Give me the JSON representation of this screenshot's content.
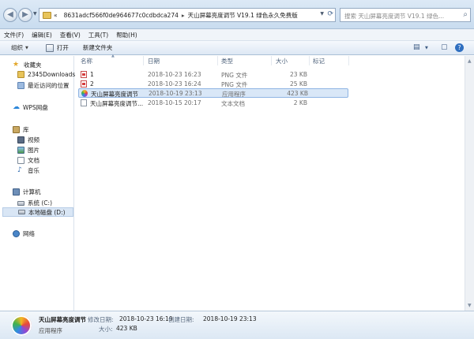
{
  "address": {
    "breadcrumb_prefix": "«",
    "crumbs": [
      "8631adcf566f0de964677c0cdbdca274",
      "天山屏幕亮度调节 V19.1 绿色永久免费版"
    ],
    "search_placeholder": "搜索 天山屏幕亮度调节 V19.1 绿色..."
  },
  "menu": [
    "文件(F)",
    "编辑(E)",
    "查看(V)",
    "工具(T)",
    "帮助(H)"
  ],
  "commands": {
    "organize": "组织",
    "open": "打开",
    "new_folder": "新建文件夹"
  },
  "sidebar": {
    "favorites": "收藏夹",
    "downloads": "2345Downloads",
    "recent": "最近访问的位置",
    "wps": "WPS网盘",
    "library": "库",
    "videos": "视频",
    "pictures": "图片",
    "documents": "文档",
    "music": "音乐",
    "computer": "计算机",
    "drive_c": "系统 (C:)",
    "drive_d": "本地磁盘 (D:)",
    "network": "网络"
  },
  "columns": {
    "name": "名称",
    "date": "日期",
    "type": "类型",
    "size": "大小",
    "tags": "标记"
  },
  "files": [
    {
      "name": "1",
      "date": "2018-10-23 16:23",
      "type": "PNG 文件",
      "size": "23 KB",
      "icon": "png-file-icon"
    },
    {
      "name": "2",
      "date": "2018-10-23 16:24",
      "type": "PNG 文件",
      "size": "25 KB",
      "icon": "png-file-icon"
    },
    {
      "name": "天山屏幕亮度调节",
      "date": "2018-10-19 23:13",
      "type": "应用程序",
      "size": "423 KB",
      "icon": "app-icon",
      "selected": true
    },
    {
      "name": "天山屏幕亮度调节...",
      "date": "2018-10-15 20:17",
      "type": "文本文档",
      "size": "2 KB",
      "icon": "text-file-icon"
    }
  ],
  "details": {
    "name": "天山屏幕亮度调节",
    "type": "应用程序",
    "modified_label": "修改日期:",
    "modified": "2018-10-23 16:19",
    "created_label": "创建日期:",
    "created": "2018-10-19 23:13",
    "size_label": "大小:",
    "size": "423 KB"
  }
}
